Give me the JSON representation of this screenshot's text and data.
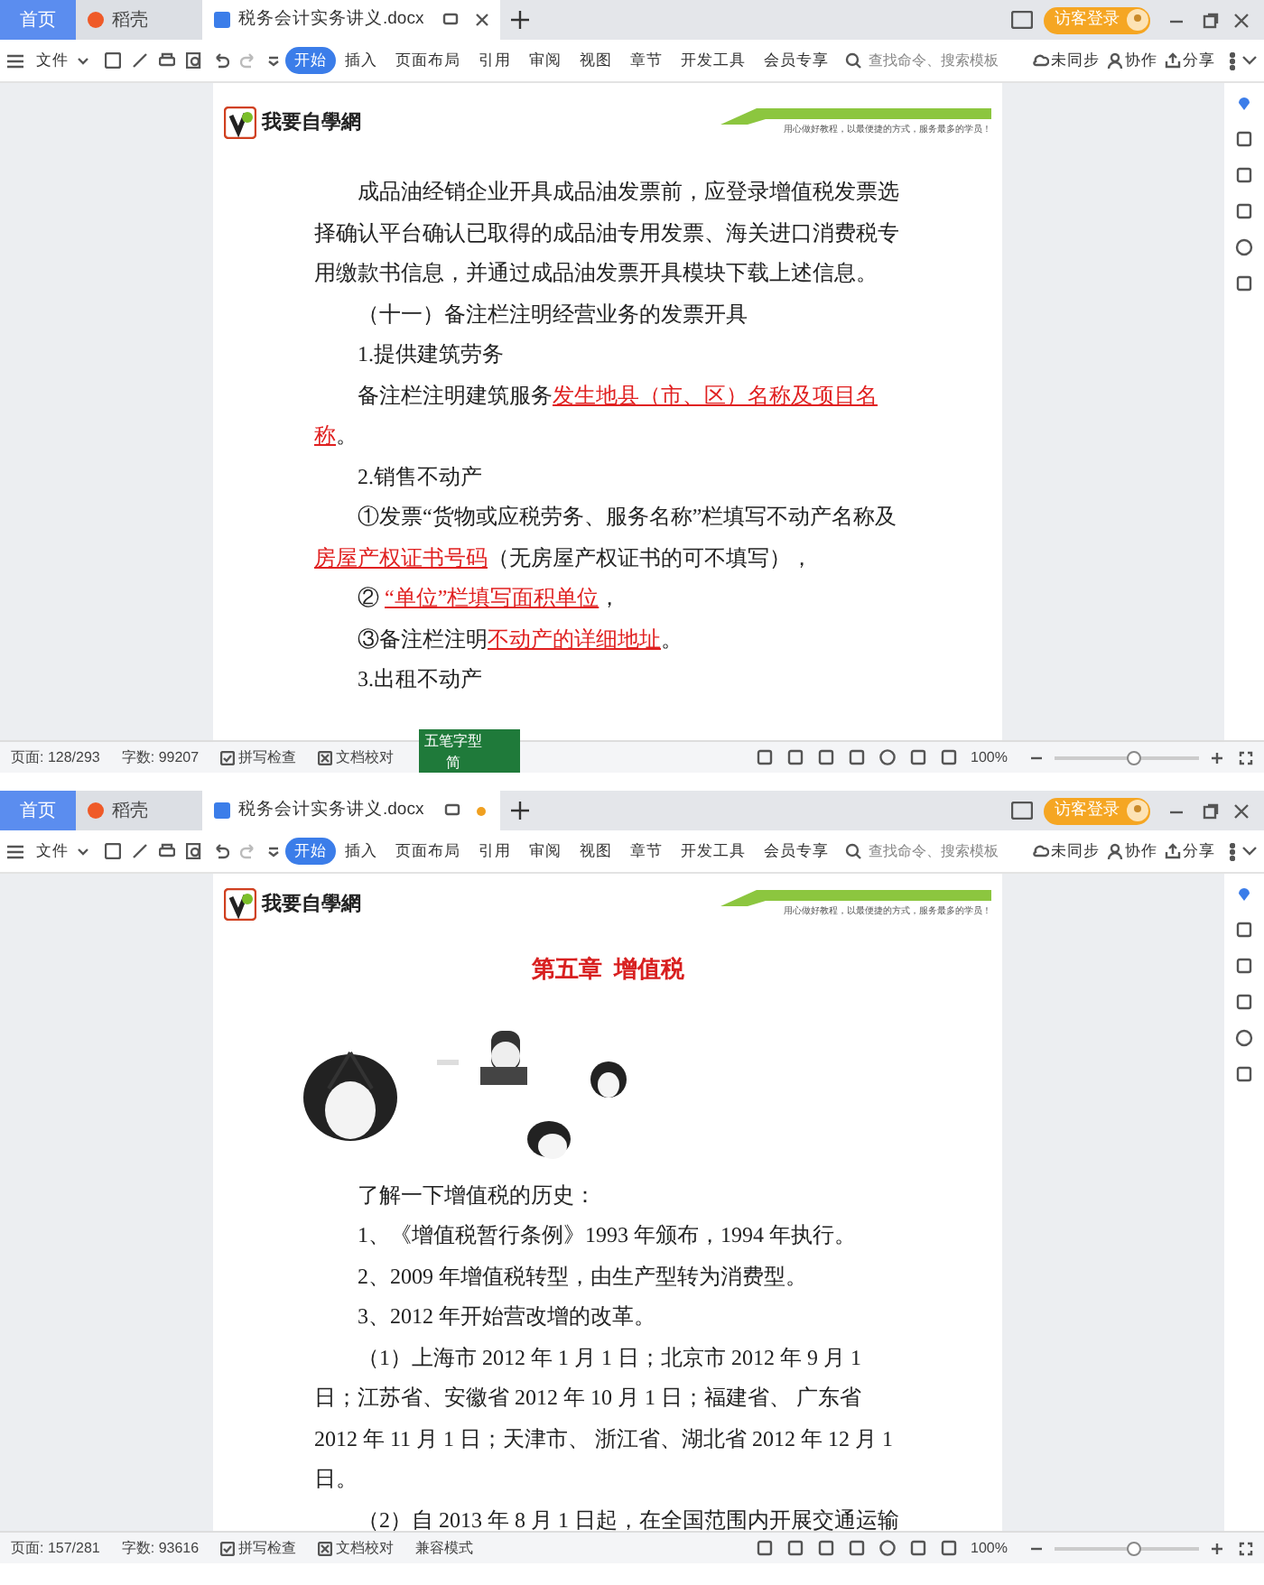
{
  "windows": [
    {
      "tabs": [
        {
          "label": "首页",
          "kind": "home",
          "selected": false
        },
        {
          "label": "稻壳",
          "kind": "app",
          "selected": false
        },
        {
          "label": "税务会计实务讲义.docx",
          "kind": "doc",
          "selected": true,
          "modified": false
        }
      ],
      "login": "访客登录",
      "menu": [
        {
          "label": "文件",
          "selected": false
        },
        {
          "label": "开始",
          "selected": true
        },
        {
          "label": "插入",
          "selected": false
        },
        {
          "label": "页面布局",
          "selected": false
        },
        {
          "label": "引用",
          "selected": false
        },
        {
          "label": "审阅",
          "selected": false
        },
        {
          "label": "视图",
          "selected": false
        },
        {
          "label": "章节",
          "selected": false
        },
        {
          "label": "开发工具",
          "selected": false
        },
        {
          "label": "会员专享",
          "selected": false
        }
      ],
      "search": {
        "placeholder": "查找命令、搜索模板"
      },
      "actions": [
        "未同步",
        "协作",
        "分享"
      ],
      "document": {
        "logo": "我要自學網",
        "tagline": "用心做好教程，以最便捷的方式，服务最多的学员！",
        "blocks": [
          {
            "kind": "para",
            "text": "成品油经销企业开具成品油发票前，应登录增值税发票选择确认平台确认已取得的成品油专用发票、海关进口消费税专用缴款书信息，并通过成品油发票开具模块下载上述信息。"
          },
          {
            "kind": "para",
            "text": "（十一）备注栏注明经营业务的发票开具"
          },
          {
            "kind": "para",
            "text": "1.提供建筑劳务"
          },
          {
            "kind": "para",
            "text": "备注栏注明建筑服务**发生地县（市、区）名称及项目名称**。"
          },
          {
            "kind": "para",
            "text": "2.销售不动产"
          },
          {
            "kind": "para",
            "text": "①发票“货物或应税劳务、服务名称”栏填写不动产名称及**房屋产权证书号码**（无房屋产权证书的可不填写），"
          },
          {
            "kind": "para",
            "text": "② **“单位”栏填写面积单位**，"
          },
          {
            "kind": "para",
            "text": "③备注栏注明**不动产的详细地址**。"
          },
          {
            "kind": "para",
            "text": "3.出租不动产"
          }
        ]
      },
      "ime": {
        "label": "五笔字型",
        "mode": "简"
      },
      "status_bar": {
        "items": [
          "页面: 128/293",
          "字数: 99207",
          "拼写检查",
          "文档校对"
        ],
        "zoom": "100%",
        "zoom_level": {
          "level": 0.55
        }
      }
    },
    {
      "tabs": [
        {
          "label": "首页",
          "kind": "home",
          "selected": false
        },
        {
          "label": "稻壳",
          "kind": "app",
          "selected": false
        },
        {
          "label": "税务会计实务讲义.docx",
          "kind": "doc",
          "selected": true,
          "modified": true
        }
      ],
      "login": "访客登录",
      "menu": [
        {
          "label": "文件",
          "selected": false
        },
        {
          "label": "开始",
          "selected": true
        },
        {
          "label": "插入",
          "selected": false
        },
        {
          "label": "页面布局",
          "selected": false
        },
        {
          "label": "引用",
          "selected": false
        },
        {
          "label": "审阅",
          "selected": false
        },
        {
          "label": "视图",
          "selected": false
        },
        {
          "label": "章节",
          "selected": false
        },
        {
          "label": "开发工具",
          "selected": false
        },
        {
          "label": "会员专享",
          "selected": false
        }
      ],
      "search": {
        "placeholder": "查找命令、搜索模板"
      },
      "actions": [
        "未同步",
        "协作",
        "分享"
      ],
      "document": {
        "logo": "我要自學網",
        "tagline": "用心做好教程，以最便捷的方式，服务最多的学员！",
        "blocks": [
          {
            "kind": "title",
            "text": "第五章  增值税"
          },
          {
            "kind": "picture"
          },
          {
            "kind": "para",
            "text": "了解一下增值税的历史："
          },
          {
            "kind": "para",
            "text": "1、《增值税暂行条例》1993 年颁布，1994 年执行。"
          },
          {
            "kind": "para",
            "text": "2、2009 年增值税转型，由生产型转为消费型。"
          },
          {
            "kind": "para",
            "text": "3、2012 年开始营改增的改革。"
          },
          {
            "kind": "para",
            "text": "（1）上海市 2012 年 1 月 1 日；北京市 2012 年 9 月 1 日；江苏省、安徽省 2012 年 10 月 1 日；福建省、 广东省 2012 年 11 月 1 日；天津市、 浙江省、湖北省 2012 年 12 月 1 日。"
          },
          {
            "kind": "para",
            "text": "（2）自 2013 年 8 月 1 日起，在全国范围内开展交通运输"
          }
        ]
      },
      "status_bar": {
        "items": [
          "页面: 157/281",
          "字数: 93616",
          "拼写检查",
          "文档校对",
          "兼容模式"
        ],
        "zoom": "100%",
        "zoom_level": {
          "level": 0.55
        }
      }
    }
  ]
}
